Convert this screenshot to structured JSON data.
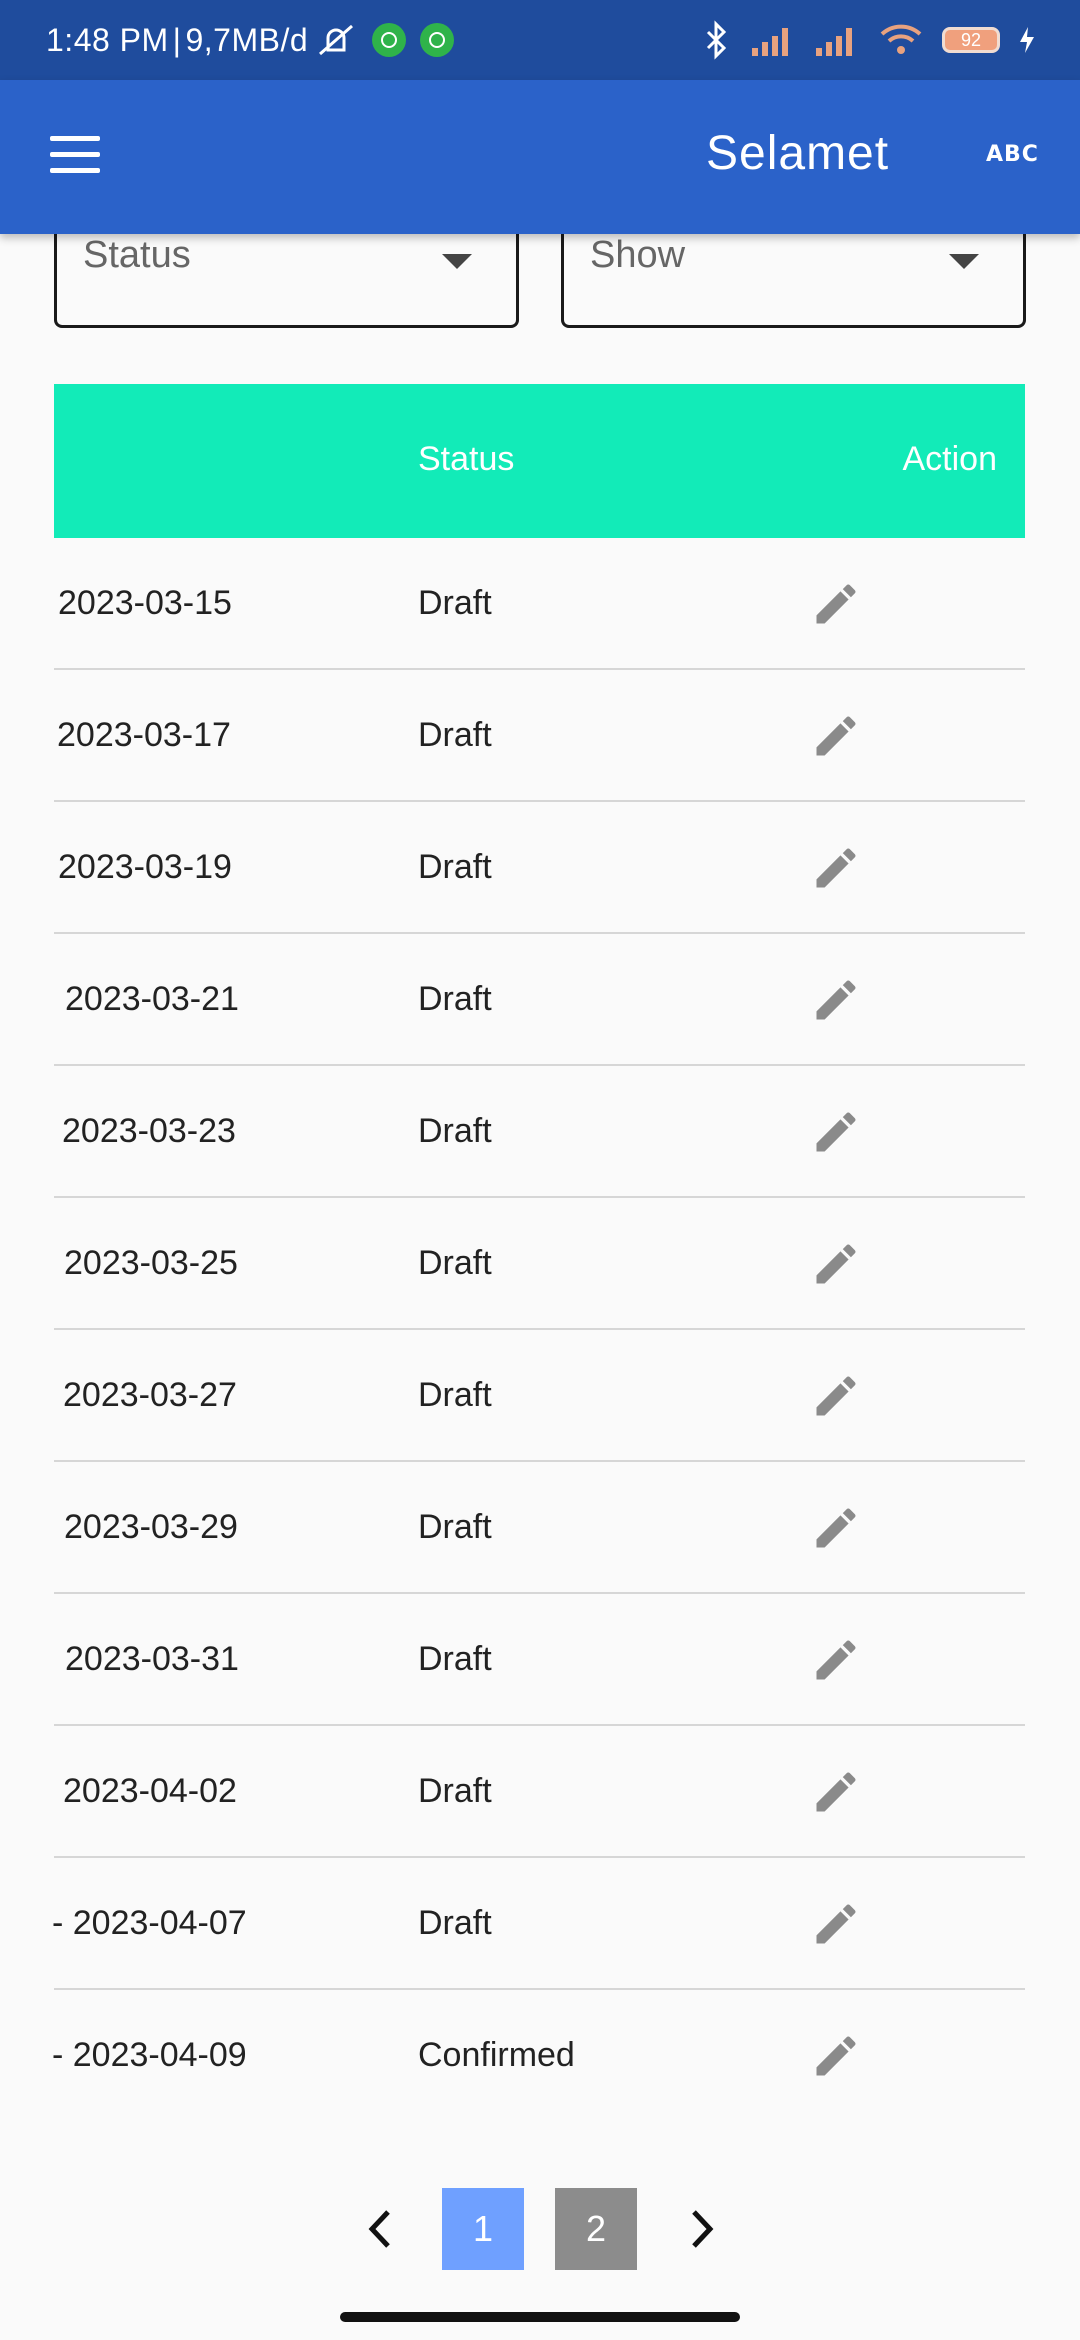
{
  "status_bar": {
    "time": "1:48 PM",
    "separator": "|",
    "data_usage": "9,7MB/d",
    "battery": "92"
  },
  "app_bar": {
    "title": "Selamet",
    "abc_label": "ABC"
  },
  "filters": {
    "status_label": "Status",
    "show_label": "Show"
  },
  "table": {
    "columns": {
      "status": "Status",
      "action": "Action"
    },
    "rows": [
      {
        "date": "2023-03-15",
        "status": "Draft"
      },
      {
        "date": "2023-03-17",
        "status": "Draft"
      },
      {
        "date": "2023-03-19",
        "status": "Draft"
      },
      {
        "date": "2023-03-21",
        "status": "Draft"
      },
      {
        "date": "2023-03-23",
        "status": "Draft"
      },
      {
        "date": "2023-03-25",
        "status": "Draft"
      },
      {
        "date": "2023-03-27",
        "status": "Draft"
      },
      {
        "date": "2023-03-29",
        "status": "Draft"
      },
      {
        "date": "2023-03-31",
        "status": "Draft"
      },
      {
        "date": "2023-04-02",
        "status": "Draft"
      },
      {
        "date": "- 2023-04-07",
        "status": "Draft"
      },
      {
        "date": "- 2023-04-09",
        "status": "Confirmed"
      }
    ]
  },
  "pagination": {
    "pages": [
      "1",
      "2"
    ],
    "current": "1"
  },
  "colors": {
    "status_bar": "#1f4c9d",
    "app_bar": "#2b62c9",
    "table_header": "#12ebb8",
    "page_active": "#6fa0ff",
    "page_inactive": "#8c8c8c",
    "edit_icon": "#8a8a8a"
  }
}
